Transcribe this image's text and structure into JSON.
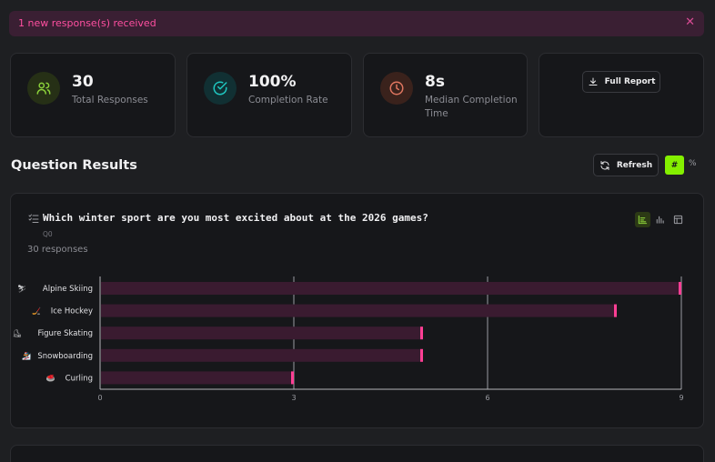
{
  "banner": {
    "message": "1 new response(s) received",
    "close_symbol": "✕"
  },
  "stats": [
    {
      "value": "30",
      "label": "Total Responses",
      "icon": "users-icon",
      "color": "#8bd13a"
    },
    {
      "value": "100%",
      "label": "Completion Rate",
      "icon": "check-circle-icon",
      "color": "#1fc7c1"
    },
    {
      "value": "8s",
      "label": "Median Completion Time",
      "icon": "clock-icon",
      "color": "#e07660"
    }
  ],
  "report": {
    "label": "Full Report"
  },
  "results": {
    "title": "Question Results",
    "refresh_label": "Refresh",
    "toggle_count": "#",
    "toggle_percent": "%"
  },
  "question": {
    "title": "Which winter sport are you most excited about at the 2026 games?",
    "id": "Q0",
    "responses": "30 responses"
  },
  "chart_data": {
    "type": "bar",
    "orientation": "horizontal",
    "categories": [
      "Alpine Skiing",
      "Ice Hockey",
      "Figure Skating",
      "Snowboarding",
      "Curling"
    ],
    "category_icons": [
      "⛷",
      "🏒",
      "⛸",
      "🏂",
      "🥌"
    ],
    "values": [
      9,
      8,
      5,
      5,
      3
    ],
    "xlim": [
      0,
      9
    ],
    "xticks": [
      0,
      3,
      6,
      9
    ],
    "grid": true,
    "bar_color": "#3a1b30",
    "cap_color": "#ff3f94"
  }
}
